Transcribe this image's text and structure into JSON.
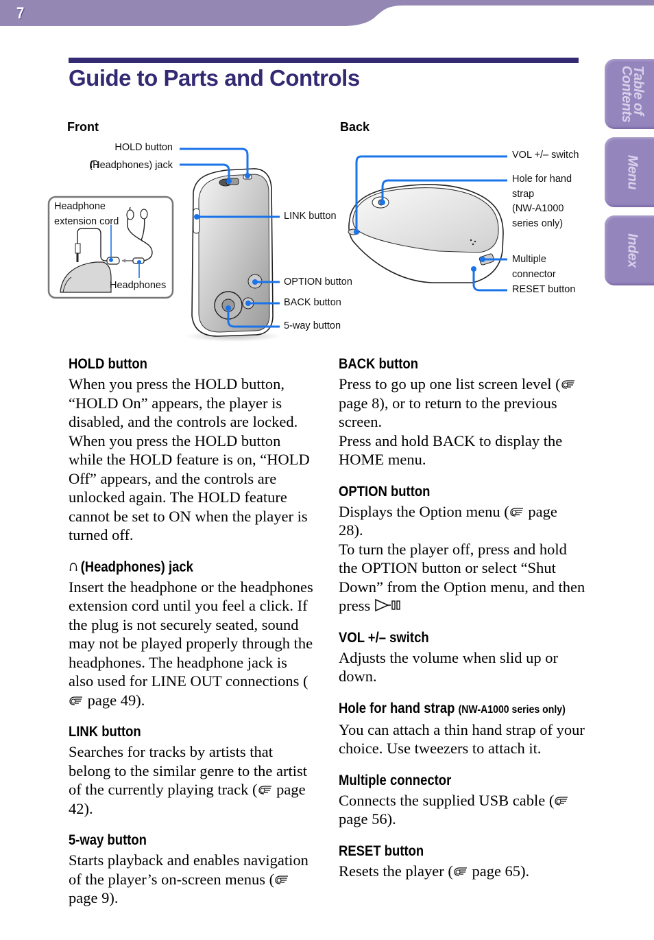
{
  "page": {
    "number": "7",
    "title": "Guide to Parts and Controls",
    "colors": {
      "band": "#9487b3",
      "title": "#332a73",
      "callout_line": "#1a73e8",
      "tab": "#9585bd"
    }
  },
  "side_tabs": [
    {
      "label": "Table of\nContents",
      "icon": "none"
    },
    {
      "label": "Menu"
    },
    {
      "label": "Index"
    }
  ],
  "figure": {
    "front": {
      "heading": "Front",
      "callouts": {
        "hold": "HOLD button",
        "headphones_jack": "(Headphones) jack",
        "link": "LINK button",
        "option": "OPTION button",
        "back": "BACK button",
        "five_way": "5-way button"
      },
      "inset": {
        "extension_cord": "Headphone\nextension cord",
        "headphones": "Headphones"
      }
    },
    "back": {
      "heading": "Back",
      "callouts": {
        "vol": "VOL +/– switch",
        "hand_strap": "Hole for hand\nstrap\n(NW-A1000\nseries only)",
        "multi_connector": "Multiple\nconnector",
        "reset": "RESET button"
      }
    }
  },
  "sections_left": {
    "hold": {
      "heading": "HOLD button",
      "body": "When you press the HOLD button, “HOLD On” appears, the player is disabled, and the controls are locked. When you press the HOLD button while the HOLD feature is on, “HOLD Off” appears, and the controls are unlocked again. The HOLD feature cannot be set to ON when the player is turned off."
    },
    "jack": {
      "heading": "(Headphones) jack",
      "body_pre": "Insert the headphone or the headphones extension cord until you feel a click. If the plug is not securely seated, sound may not be played properly through the headphones. The headphone jack is also used for LINE OUT connections (",
      "ref": "page 49",
      "body_post": ")."
    },
    "link": {
      "heading": "LINK button",
      "body_pre": "Searches for tracks by artists that belong to the similar genre to the artist of the currently playing track (",
      "ref": "page 42",
      "body_post": ")."
    },
    "five_way": {
      "heading": "5-way button",
      "body_pre": "Starts playback and enables navigation of the player’s on-screen menus (",
      "ref": "page 9",
      "body_post": ")."
    }
  },
  "sections_right": {
    "back": {
      "heading": "BACK button",
      "body_pre": "Press to go up one list screen level (",
      "ref": "page 8",
      "body_post": "), or to return to the previous screen.",
      "body2": "Press and hold BACK to display the HOME menu."
    },
    "option": {
      "heading": "OPTION button",
      "body_pre": "Displays the Option menu (",
      "ref": "page 28",
      "body_post": ").",
      "body2": "To turn the player off, press and hold the OPTION button or select “Shut Down” from the Option menu, and then press"
    },
    "vol": {
      "heading": "VOL +/– switch",
      "body": "Adjusts the volume when slid up or down."
    },
    "strap": {
      "heading": "Hole for hand strap",
      "heading_note": "(NW-A1000 series only)",
      "body": "You can attach a thin hand strap of your choice. Use tweezers to attach it."
    },
    "connector": {
      "heading": "Multiple connector",
      "body_pre": "Connects the supplied USB cable (",
      "ref": "page 56",
      "body_post": ")."
    },
    "reset": {
      "heading": "RESET button",
      "body_pre": "Resets the player (",
      "ref": "page 65",
      "body_post": ")."
    }
  }
}
